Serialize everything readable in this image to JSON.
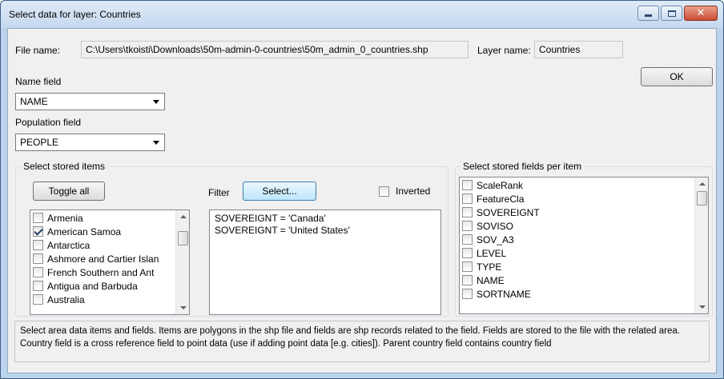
{
  "window": {
    "title": "Select data for layer: Countries"
  },
  "file": {
    "label": "File name:",
    "value": "C:\\Users\\tkoisti\\Downloads\\50m-admin-0-countries\\50m_admin_0_countries.shp"
  },
  "layer": {
    "label": "Layer name:",
    "value": "Countries"
  },
  "ok_label": "OK",
  "name_field": {
    "label": "Name field",
    "selected": "NAME"
  },
  "population_field": {
    "label": "Population field",
    "selected": "PEOPLE"
  },
  "stored_items": {
    "title": "Select stored items",
    "toggle_label": "Toggle all",
    "filter_label": "Filter",
    "select_label": "Select...",
    "inverted_label": "Inverted",
    "items": [
      {
        "label": "Armenia",
        "checked": false
      },
      {
        "label": "American Samoa",
        "checked": true
      },
      {
        "label": "Antarctica",
        "checked": false
      },
      {
        "label": "Ashmore and Cartier Islan",
        "checked": false
      },
      {
        "label": "French Southern and Ant",
        "checked": false
      },
      {
        "label": "Antigua and Barbuda",
        "checked": false
      },
      {
        "label": "Australia",
        "checked": false
      }
    ],
    "filters": [
      "SOVEREIGNT = 'Canada'",
      "SOVEREIGNT = 'United States'"
    ]
  },
  "stored_fields": {
    "title": "Select stored fields per item",
    "fields": [
      "ScaleRank",
      "FeatureCla",
      "SOVEREIGNT",
      "SOVISO",
      "SOV_A3",
      "LEVEL",
      "TYPE",
      "NAME",
      "SORTNAME"
    ]
  },
  "info_text": "Select area data items and fields. Items are polygons in the shp file and fields are shp records related to the field. Fields are stored to the file with the related area. Country field is a cross reference field to point data (use if adding point data [e.g. cities]). Parent country field contains country field"
}
